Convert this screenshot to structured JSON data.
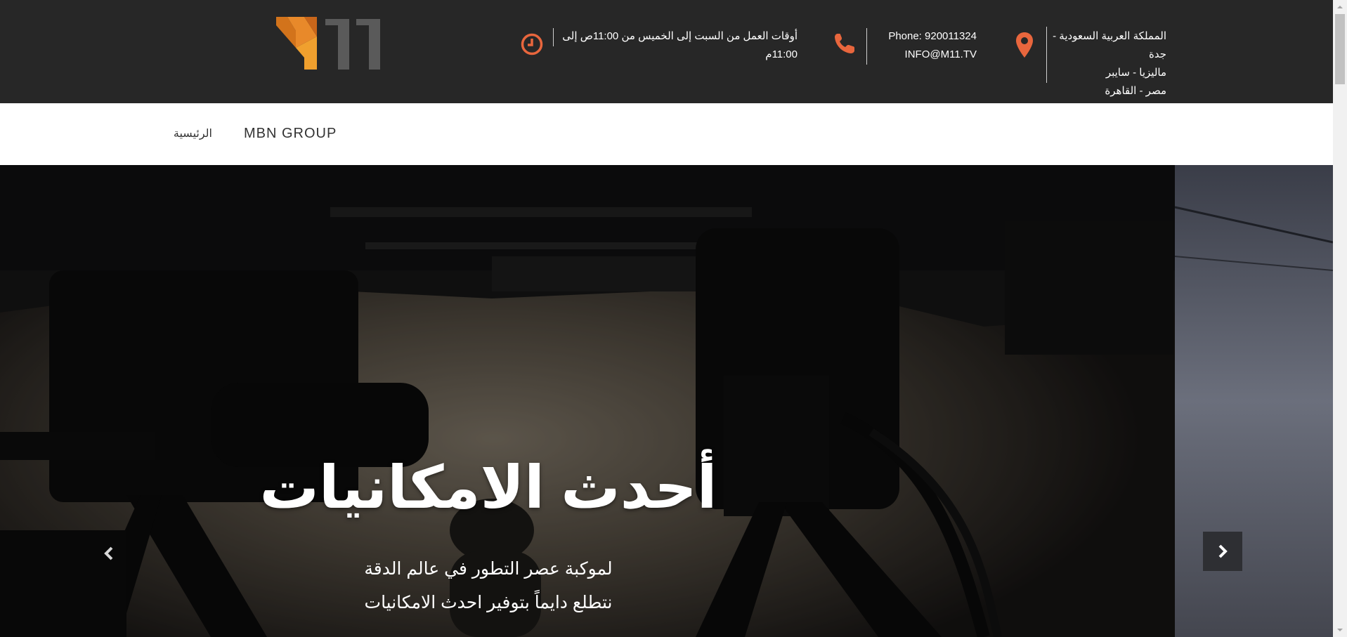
{
  "header": {
    "logo_text": "M11",
    "location_lines": [
      "المملكة العربية السعودية - جدة",
      "ماليزيا - سايبر",
      "مصر - القاهرة"
    ],
    "phone_line": "Phone: 920011324",
    "email_line": "INFO@M11.TV",
    "hours_line": "أوقات العمل من السبت إلى الخميس من 11:00ص إلى 11:00م",
    "icons": [
      "map-pin-icon",
      "phone-icon",
      "clock-icon"
    ],
    "accent_color": "#e8663d",
    "bar_color": "#272727"
  },
  "nav": {
    "items": [
      {
        "label": "الرئيسية"
      },
      {
        "label": "MBN GROUP"
      }
    ]
  },
  "hero": {
    "title": "أحدث الامكانيات",
    "subtitle_1": "لموكبة عصر التطور في عالم الدقة",
    "subtitle_2": "نتطلع دايماً بتوفير احدث الامكانيات",
    "prev_icon": "chevron-left-icon",
    "next_icon": "chevron-right-icon"
  }
}
